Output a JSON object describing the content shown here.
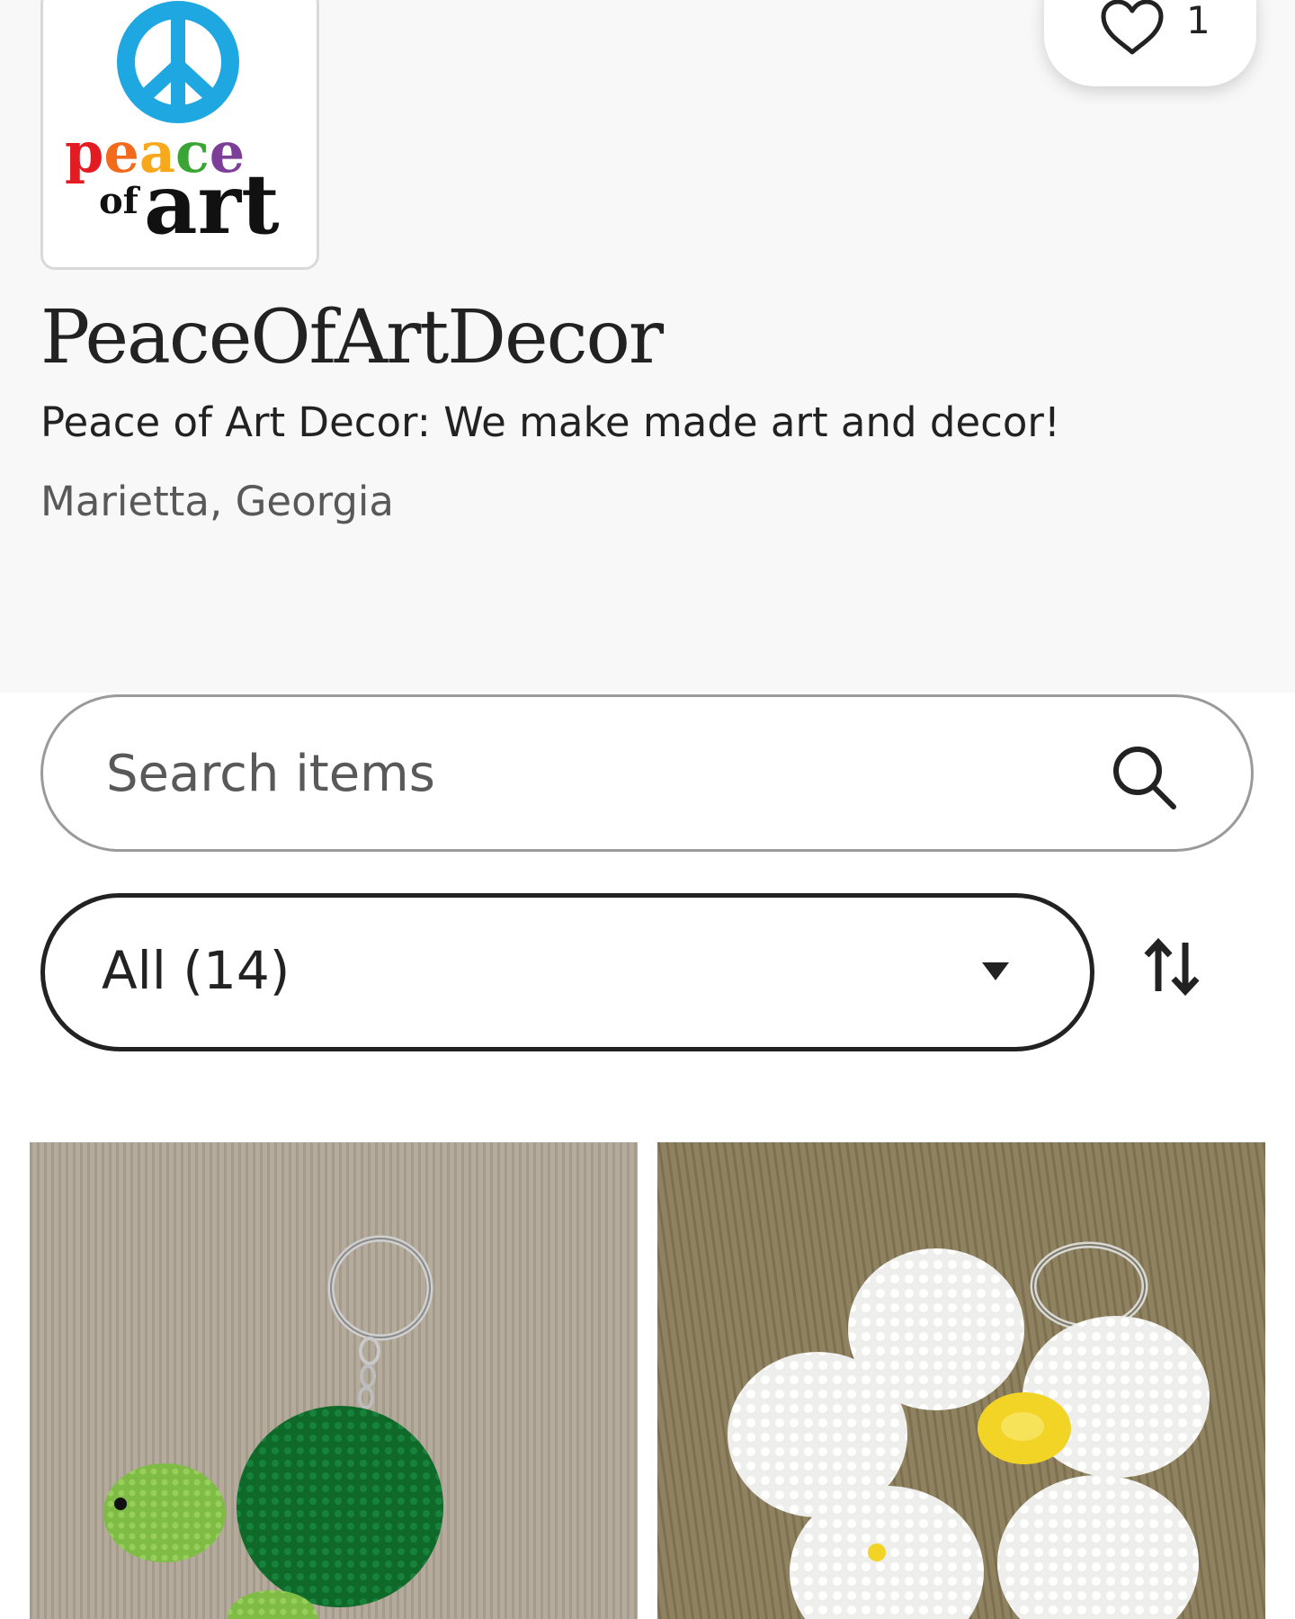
{
  "shop": {
    "logo": {
      "alt": "peace of art",
      "word_top": "peace",
      "word_small": "of",
      "word_bottom": "art",
      "symbol_color": "#1ea7e1"
    },
    "name": "PeaceOfArtDecor",
    "tagline": "Peace of Art Decor: We make made art and decor!",
    "location": "Marietta, Georgia",
    "favorites": {
      "icon": "heart-icon",
      "count": "1"
    }
  },
  "search": {
    "placeholder": "Search items",
    "icon": "search-icon"
  },
  "filter": {
    "selected": "All (14)",
    "icon": "caret-down-icon",
    "sort_icon": "sort-arrows-icon"
  },
  "listings": [
    {
      "image": "crocheted green turtle keychain on ring"
    },
    {
      "image": "crocheted white flower keychain with yellow center on ring"
    }
  ]
}
